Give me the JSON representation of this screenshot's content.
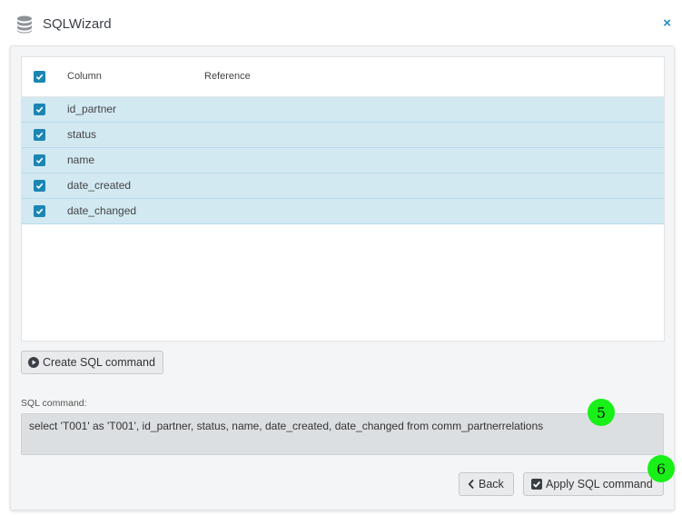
{
  "window": {
    "title": "SQLWizard",
    "close_label": "×"
  },
  "grid": {
    "headers": {
      "column": "Column",
      "reference": "Reference"
    },
    "rows": [
      {
        "column": "id_partner",
        "reference": "",
        "checked": true
      },
      {
        "column": "status",
        "reference": "",
        "checked": true
      },
      {
        "column": "name",
        "reference": "",
        "checked": true
      },
      {
        "column": "date_created",
        "reference": "",
        "checked": true
      },
      {
        "column": "date_changed",
        "reference": "",
        "checked": true
      }
    ]
  },
  "actions": {
    "create_label": "Create SQL command",
    "back_label": "Back",
    "apply_label": "Apply SQL command"
  },
  "sql": {
    "label": "SQL command:",
    "value": "select 'T001' as 'T001', id_partner, status, name, date_created, date_changed from comm_partnerrelations"
  },
  "markers": [
    {
      "label": "5"
    },
    {
      "label": "6"
    }
  ],
  "colors": {
    "accent": "#1b86b3",
    "row_selected": "#d2e9f2",
    "marker": "#18f018"
  }
}
